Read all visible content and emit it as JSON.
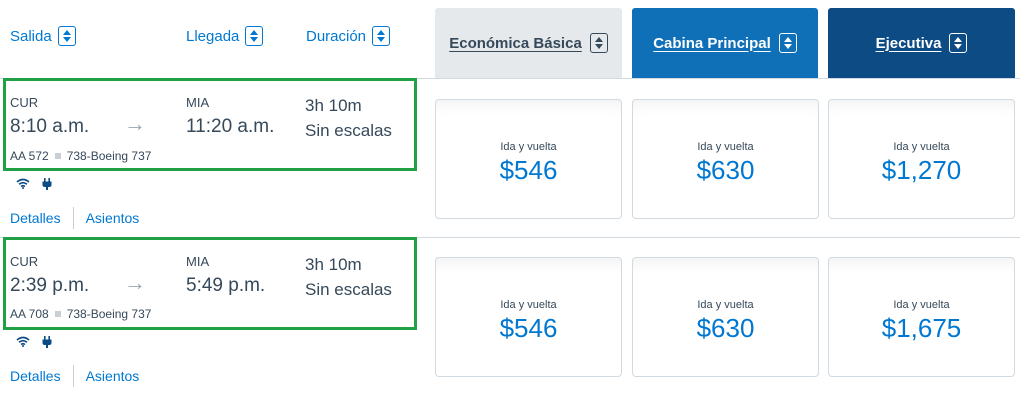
{
  "header": {
    "sort_departure": "Salida",
    "sort_arrival": "Llegada",
    "sort_duration": "Duración"
  },
  "cabins": {
    "basic": "Económica Básica",
    "main": "Cabina Principal",
    "executive": "Ejecutiva"
  },
  "flights": [
    {
      "origin": "CUR",
      "depart_time": "8:10 a.m.",
      "destination": "MIA",
      "arrive_time": "11:20 a.m.",
      "duration": "3h 10m",
      "stops": "Sin escalas",
      "flight_number": "AA 572",
      "aircraft": "738-Boeing 737",
      "details_link": "Detalles",
      "seats_link": "Asientos",
      "fares": [
        {
          "label": "Ida y vuelta",
          "price": "$546"
        },
        {
          "label": "Ida y vuelta",
          "price": "$630"
        },
        {
          "label": "Ida y vuelta",
          "price": "$1,270"
        }
      ]
    },
    {
      "origin": "CUR",
      "depart_time": "2:39 p.m.",
      "destination": "MIA",
      "arrive_time": "5:49 p.m.",
      "duration": "3h 10m",
      "stops": "Sin escalas",
      "flight_number": "AA 708",
      "aircraft": "738-Boeing 737",
      "details_link": "Detalles",
      "seats_link": "Asientos",
      "fares": [
        {
          "label": "Ida y vuelta",
          "price": "$546"
        },
        {
          "label": "Ida y vuelta",
          "price": "$630"
        },
        {
          "label": "Ida y vuelta",
          "price": "$1,675"
        }
      ]
    }
  ],
  "icons": [
    "sort-icon",
    "arrow-right-icon",
    "wifi-icon",
    "power-icon"
  ],
  "colors": {
    "link": "#0078d2",
    "tab_basic": "#e6e9ec",
    "tab_main": "#0f6fb7",
    "tab_executive": "#0d4b85",
    "highlight": "#22a045"
  }
}
